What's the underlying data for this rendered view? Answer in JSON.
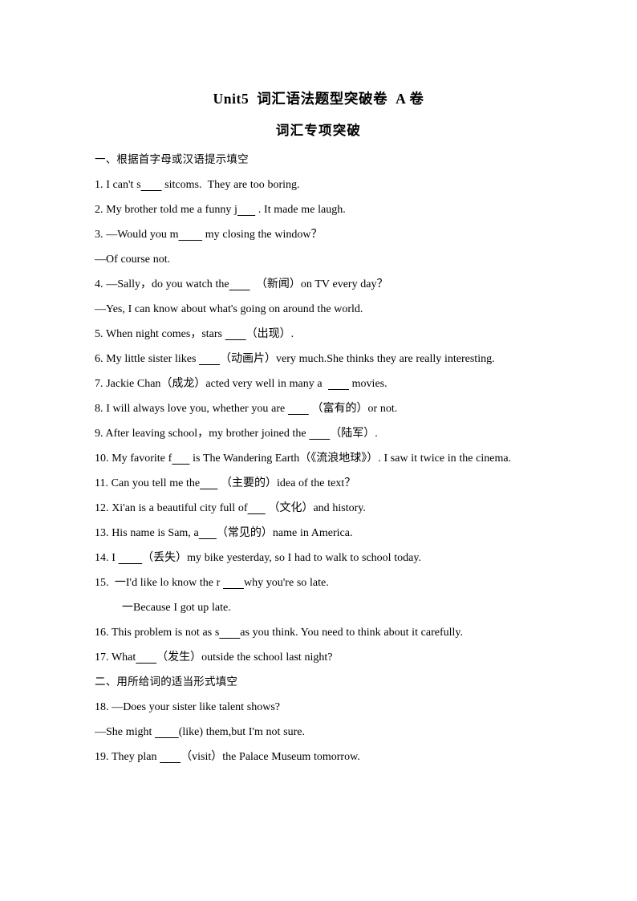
{
  "document": {
    "title": "Unit5  词汇语法题型突破卷  A 卷",
    "subtitle": "词汇专项突破"
  },
  "sections": [
    {
      "heading": "一、根据首字母或汉语提示填空",
      "lines": [
        "1. I can't s_______ sitcoms.  They are too boring.",
        "2. My brother told me a funny j______ . It made me laugh.",
        "3. —Would you m________ my closing the window？",
        "—Of course not.",
        "4. —Sally，do you watch the_______  （新闻）on TV every day？",
        "—Yes, I can know about what's going on around the world.",
        "5. When night comes，stars _______（出现）.",
        "6.  My  little  sister  likes  _______（动画片）very  much.She  thinks  they  are  really interesting.",
        "7. Jackie Chan（成龙）acted very well in many a  _______ movies.",
        "8. I will always love you, whether you are _______ （富有的）or not.",
        "9. After leaving school，my brother joined the _______（陆军）.",
        "10. My favorite f______ is The Wandering Earth（《流浪地球》）. I saw it twice in the cinema.",
        "11. Can you tell me the______ （主要的）idea of the text？",
        "12. Xi'an is a beautiful city full of______ （文化）and history.",
        "13. His name is Sam, a______（常见的）name in America.",
        "14. I ________（丢失）my bike yesterday, so I had to walk to school today.",
        "15.  一I'd like lo know the r _______why you're so late.",
        "一Because I got up late.",
        "16. This problem is not as s_______as you think. You need to think about it carefully.",
        "17. What_______（发生）outside the school last night?"
      ]
    },
    {
      "heading": "二、用所给词的适当形式填空",
      "lines": [
        "18. —Does your sister like talent shows?",
        "—She might ________(like) them,but I'm not sure.",
        "19. They plan _______（visit）the Palace Museum tomorrow."
      ]
    }
  ],
  "line_styles": {
    "justified_indices": {
      "section0": [
        7,
        11
      ]
    },
    "indented_indices": {
      "section0": [
        17
      ]
    }
  }
}
